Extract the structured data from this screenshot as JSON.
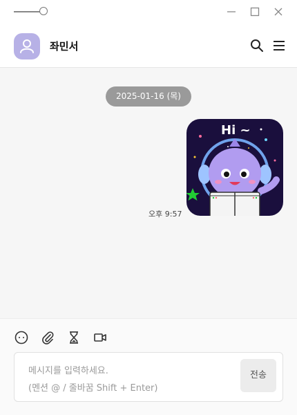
{
  "header": {
    "contact_name": "좌민서"
  },
  "chat": {
    "date": "2025-01-16 (목)",
    "messages": [
      {
        "type": "sticker",
        "sticker_text": "Hi ~",
        "time": "오후 9:57"
      }
    ]
  },
  "composer": {
    "placeholder_line1": "메시지를 입력하세요.",
    "placeholder_line2": "(멘션 @ / 줄바꿈 Shift + Enter)",
    "send_label": "전송"
  },
  "toolbar": {
    "icons": [
      "emoji-icon",
      "attach-icon",
      "hourglass-icon",
      "video-icon"
    ]
  },
  "colors": {
    "avatar": "#b7b1e6",
    "date_pill": "#9a9a9a",
    "sticker_bg": "#1a0f3d",
    "sticker_char": "#b19cf0"
  }
}
